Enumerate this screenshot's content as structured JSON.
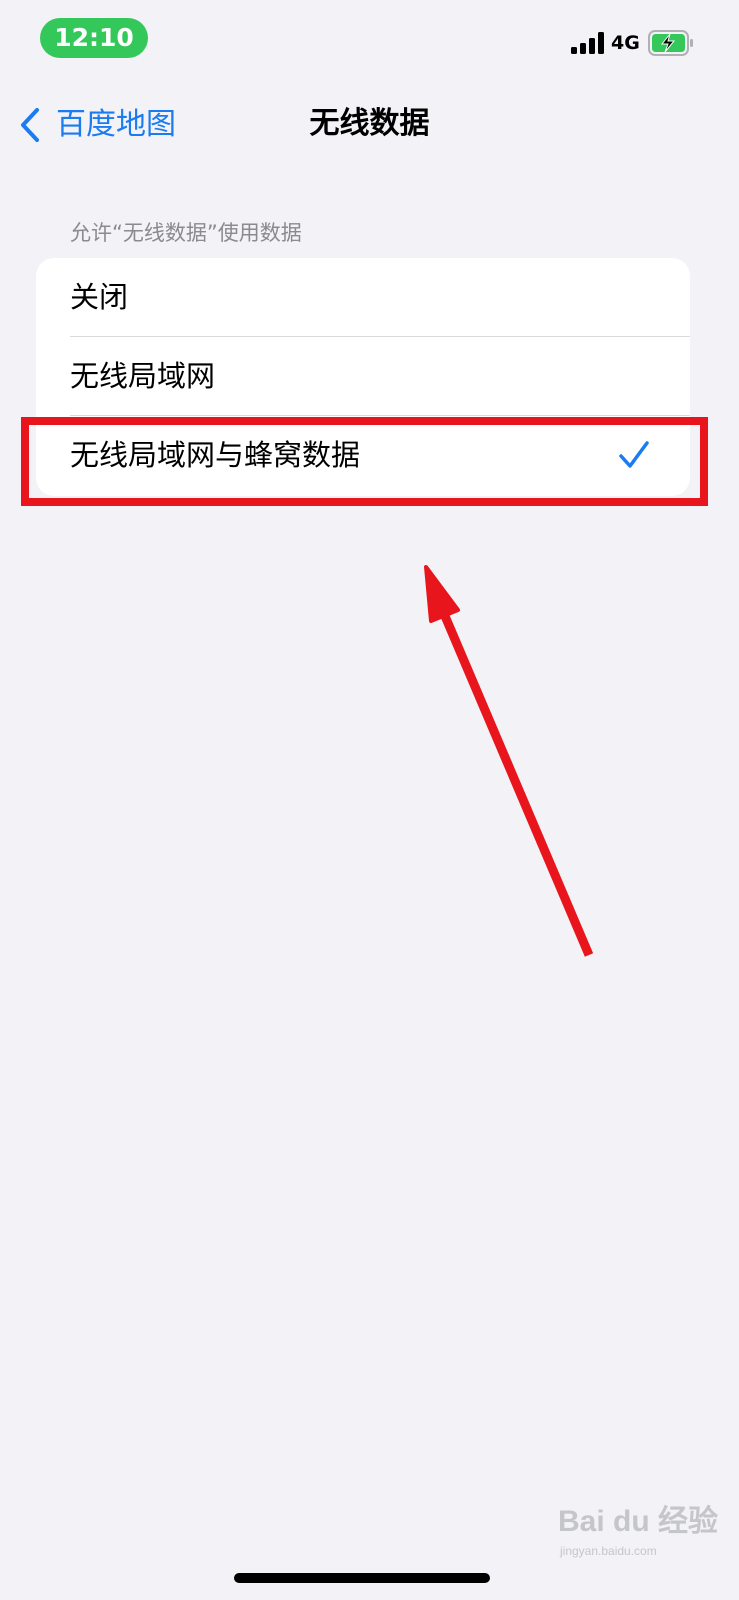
{
  "status_bar": {
    "time": "12:10",
    "network": "4G",
    "signal_icon": "cellular-signal-icon",
    "battery_icon": "battery-charging-icon",
    "time_pill_color": "#34c759"
  },
  "nav": {
    "back_label": "百度地图",
    "back_icon": "chevron-left-icon",
    "title": "无线数据",
    "accent_color": "#1a7cf0"
  },
  "section": {
    "header": "允许“无线数据”使用数据"
  },
  "options": [
    {
      "label": "关闭",
      "selected": false
    },
    {
      "label": "无线局域网",
      "selected": false
    },
    {
      "label": "无线局域网与蜂窝数据",
      "selected": true
    }
  ],
  "check_icon": "checkmark-icon",
  "annotation": {
    "color": "#e8161c",
    "box_target": "无线局域网与蜂窝数据",
    "arrow_icon": "red-arrow-icon"
  },
  "watermark": {
    "main": "Bai du 经验",
    "sub": "jingyan.baidu.com"
  }
}
